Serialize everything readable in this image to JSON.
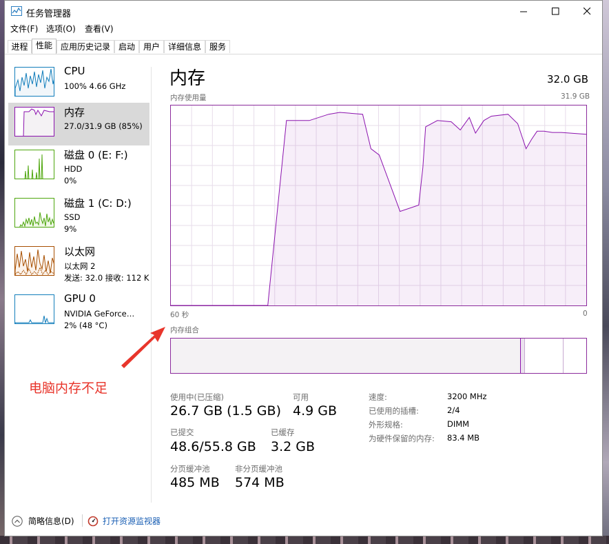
{
  "window": {
    "title": "任务管理器"
  },
  "menu": [
    "文件(F)",
    "选项(O)",
    "查看(V)"
  ],
  "tabs": [
    "进程",
    "性能",
    "应用历史记录",
    "启动",
    "用户",
    "详细信息",
    "服务"
  ],
  "active_tab": "性能",
  "sidebar": [
    {
      "name": "CPU",
      "line1": "100% 4.66 GHz",
      "line2": "",
      "color": "#117dbb"
    },
    {
      "name": "内存",
      "line1": "27.0/31.9 GB (85%)",
      "line2": "",
      "color": "#8b12ae"
    },
    {
      "name": "磁盘 0 (E: F:)",
      "line1": "HDD",
      "line2": "0%",
      "color": "#4da60c"
    },
    {
      "name": "磁盘 1 (C: D:)",
      "line1": "SSD",
      "line2": "9%",
      "color": "#4da60c"
    },
    {
      "name": "以太网",
      "line1": "以太网 2",
      "line2": "发送: 32.0 接收: 112 K",
      "color": "#a74f01"
    },
    {
      "name": "GPU 0",
      "line1": "NVIDIA GeForce…",
      "line2": "2% (48 °C)",
      "color": "#117dbb"
    }
  ],
  "main": {
    "title": "内存",
    "total": "32.0 GB",
    "usage_label": "内存使用量",
    "usage_max": "31.9 GB",
    "time_left": "60 秒",
    "time_right": "0",
    "composition_label": "内存组合"
  },
  "stats": {
    "in_use_label": "使用中(已压缩)",
    "in_use_value": "26.7 GB (1.5 GB)",
    "available_label": "可用",
    "available_value": "4.9 GB",
    "committed_label": "已提交",
    "committed_value": "48.6/55.8 GB",
    "cached_label": "已缓存",
    "cached_value": "3.2 GB",
    "paged_label": "分页缓冲池",
    "paged_value": "485 MB",
    "nonpaged_label": "非分页缓冲池",
    "nonpaged_value": "574 MB"
  },
  "specs": [
    {
      "label": "速度:",
      "value": "3200 MHz"
    },
    {
      "label": "已使用的插槽:",
      "value": "2/4"
    },
    {
      "label": "外形规格:",
      "value": "DIMM"
    },
    {
      "label": "为硬件保留的内存:",
      "value": "83.4 MB"
    }
  ],
  "footer": {
    "fewer_details": "简略信息(D)",
    "resource_monitor": "打开资源监视器"
  },
  "annotation": {
    "text": "电脑内存不足",
    "color": "#e8352b"
  },
  "chart_data": {
    "type": "area",
    "title": "内存使用量",
    "ylim": [
      0,
      31.9
    ],
    "x_range_seconds": [
      60,
      0
    ],
    "x": [
      60,
      46,
      43.3,
      40,
      37.2,
      35.6,
      32.3,
      31.1,
      29.9,
      26.9,
      24.2,
      23.6,
      23.2,
      21.5,
      19.5,
      18.2,
      16.9,
      16,
      14.8,
      13.7,
      11.3,
      9.9,
      8.7,
      7.9,
      7.1,
      6.1,
      4.9,
      3.6,
      0
    ],
    "series": [
      {
        "values": [
          0,
          0,
          29.5,
          29.5,
          30.5,
          30.8,
          30.5,
          25,
          24,
          15,
          16,
          22,
          28.5,
          29.5,
          29.3,
          28,
          30,
          27.5,
          29.5,
          30.2,
          30.5,
          29,
          25,
          26.5,
          27.8,
          27.8,
          27.6,
          27.6,
          27.3
        ]
      }
    ]
  }
}
